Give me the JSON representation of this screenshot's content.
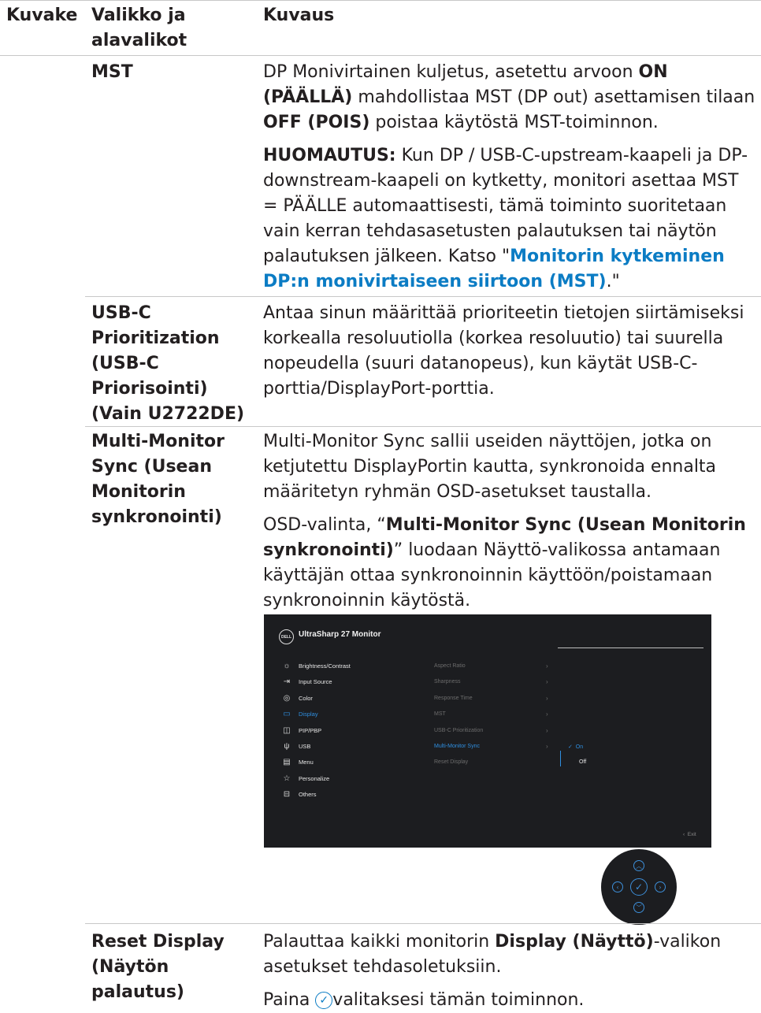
{
  "header": {
    "col_icon": "Kuvake",
    "col_menu_line1": "Valikko ja",
    "col_menu_line2": "alavalikot",
    "col_desc": "Kuvaus"
  },
  "rows": {
    "mst": {
      "name": "MST",
      "p1_a": "DP Monivirtainen kuljetus, asetettu arvoon ",
      "p1_b": "ON (PÄÄLLÄ)",
      "p1_c": " mahdollistaa MST (DP out) asettamisen tilaan ",
      "p1_d": "OFF (POIS)",
      "p1_e": " poistaa käytöstä MST-toiminnon.",
      "note_label": "HUOMAUTUS:",
      "note_text": " Kun DP / USB-C-upstream-kaapeli ja DP-downstream-kaapeli on kytketty, monitori asettaa MST = PÄÄLLE automaattisesti, tämä toiminto suoritetaan vain kerran tehdasasetusten palautuksen tai näytön palautuksen jälkeen. Katso \"",
      "link": "Monitorin kytkeminen DP:n monivirtaiseen siirtoon (MST)",
      "note_end": ".\""
    },
    "usbc": {
      "name_l1": "USB-C",
      "name_l2": "Prioritization",
      "name_l3": "(USB-C",
      "name_l4": "Priorisointi)",
      "name_l5": "(Vain U2722DE)",
      "desc": "Antaa sinun määrittää prioriteetin tietojen siirtämiseksi korkealla resoluutiolla (korkea resoluutio) tai suurella nopeudella (suuri datanopeus), kun käytät USB-C-porttia/DisplayPort-porttia."
    },
    "mms": {
      "name_l1": "Multi-Monitor",
      "name_l2": "Sync (Usean",
      "name_l3": "Monitorin",
      "name_l4": "synkronointi)",
      "p1": "Multi-Monitor Sync sallii useiden näyttöjen, jotka on ketjutettu DisplayPortin kautta, synkronoida ennalta määritetyn ryhmän OSD-asetukset taustalla.",
      "p2_a": "OSD-valinta, “",
      "p2_b": "Multi-Monitor Sync (Usean Monitorin synkronointi)",
      "p2_c": "” luodaan Näyttö-valikossa antamaan käyttäjän ottaa synkronoinnin käyttöön/poistamaan synkronoinnin käytöstä."
    },
    "reset": {
      "name_l1": "Reset Display",
      "name_l2": "(Näytön",
      "name_l3": "palautus)",
      "p1_a": "Palauttaa kaikki monitorin ",
      "p1_b": "Display (Näyttö)",
      "p1_c": "-valikon asetukset tehdasoletuksiin.",
      "p2_a": "Paina ",
      "p2_b": "valitaksesi tämän toiminnon."
    }
  },
  "osd": {
    "logo": "DELL",
    "title": "UltraSharp 27 Monitor",
    "menu": [
      {
        "label": "Brightness/Contrast",
        "icon": "sun-icon"
      },
      {
        "label": "Input Source",
        "icon": "input-icon"
      },
      {
        "label": "Color",
        "icon": "palette-icon"
      },
      {
        "label": "Display",
        "icon": "monitor-icon",
        "active": true
      },
      {
        "label": "PIP/PBP",
        "icon": "pip-icon"
      },
      {
        "label": "USB",
        "icon": "usb-icon"
      },
      {
        "label": "Menu",
        "icon": "menu-icon"
      },
      {
        "label": "Personalize",
        "icon": "star-icon"
      },
      {
        "label": "Others",
        "icon": "others-icon"
      }
    ],
    "submenu": [
      "Aspect Ratio",
      "Sharpness",
      "Response Time",
      "MST",
      "USB-C Prioritization",
      "Multi-Monitor Sync",
      "Reset Display"
    ],
    "options": {
      "on": "On",
      "off": "Off"
    },
    "exit": "Exit",
    "accent": "#2f8fe0"
  }
}
